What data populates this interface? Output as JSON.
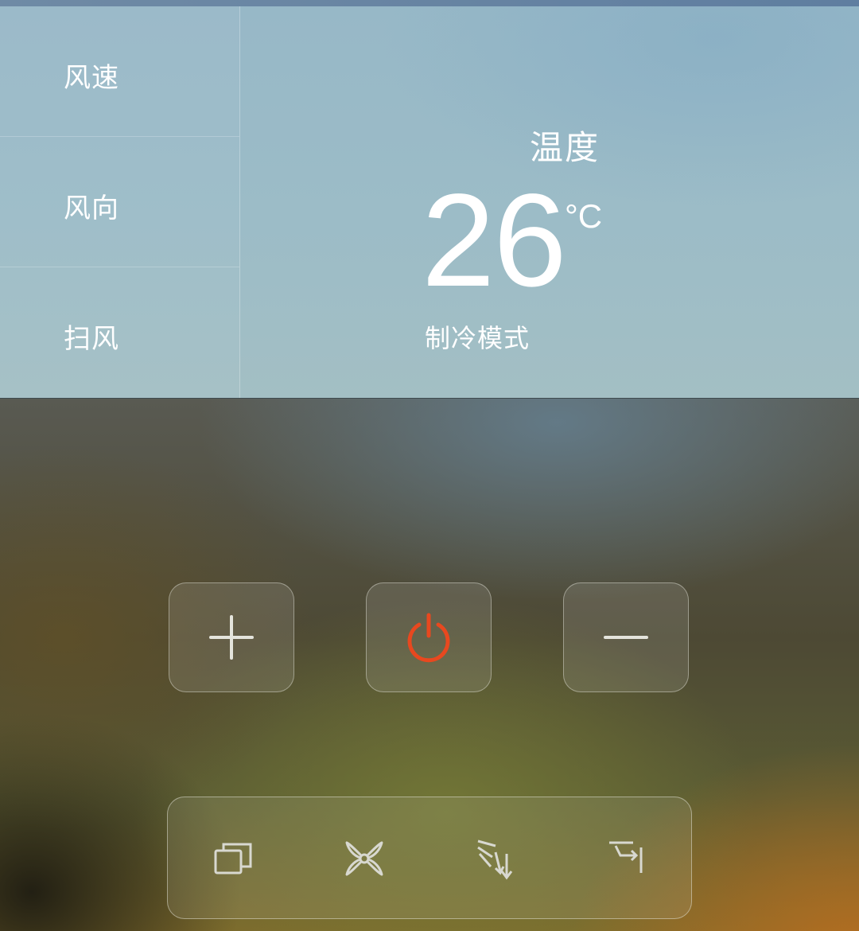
{
  "side_menu": {
    "items": [
      {
        "label": "风速"
      },
      {
        "label": "风向"
      },
      {
        "label": "扫风"
      }
    ]
  },
  "temperature": {
    "title": "温度",
    "value": "26",
    "unit": "°C",
    "mode": "制冷模式"
  },
  "controls": {
    "buttons": [
      {
        "icon": "plus-icon"
      },
      {
        "icon": "power-icon",
        "color": "#e8481f"
      },
      {
        "icon": "minus-icon"
      }
    ]
  },
  "toolbar": {
    "buttons": [
      {
        "icon": "windows-stack-icon"
      },
      {
        "icon": "fan-icon"
      },
      {
        "icon": "airflow-direction-icon"
      },
      {
        "icon": "swing-icon"
      }
    ]
  },
  "colors": {
    "power_accent": "#e8481f",
    "icon_light": "#d8d8d0",
    "text": "#ffffff"
  }
}
